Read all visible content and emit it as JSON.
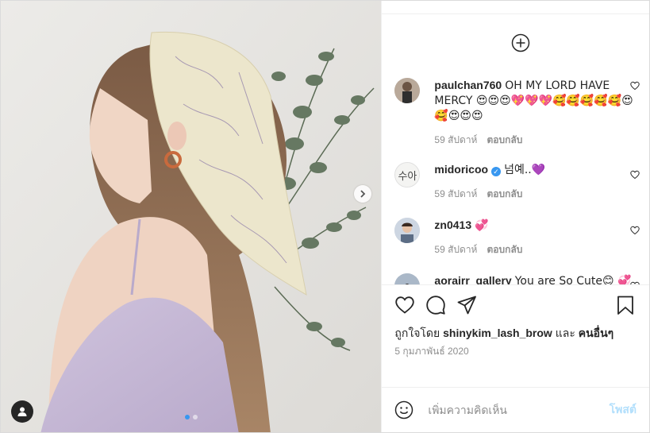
{
  "media": {
    "carousel_index": 0,
    "carousel_count": 2,
    "next_icon": "chevron-right-icon",
    "user_tag_icon": "person-icon"
  },
  "panel": {
    "load_more_icon": "plus-circle-icon",
    "comments": [
      {
        "username": "paulchan760",
        "text": "OH MY LORD HAVE MERCY 😍😍😍💖💖💖🥰🥰🥰🥰🥰😍🥰😍😍😍",
        "time": "59 สัปดาห์",
        "reply": "ตอบกลับ",
        "verified": false
      },
      {
        "username": "midoricoo",
        "text": "넘예..💜",
        "time": "59 สัปดาห์",
        "reply": "ตอบกลับ",
        "verified": true,
        "avatar_text": "수아"
      },
      {
        "username": "zn0413",
        "text": "💞",
        "time": "59 สัปดาห์",
        "reply": "ตอบกลับ",
        "verified": false
      },
      {
        "username": "aorairr_gallery",
        "text": "You are So Cute😊 💞",
        "verified": false
      }
    ]
  },
  "actions": {
    "like_icon": "heart-icon",
    "comment_icon": "comment-icon",
    "share_icon": "paper-plane-icon",
    "save_icon": "bookmark-icon",
    "likes_prefix": "ถูกใจโดย",
    "likes_user": "shinykim_lash_brow",
    "likes_and": "และ",
    "likes_others": "คนอื่นๆ",
    "date": "5 กุมภาพันธ์ 2020"
  },
  "add_comment": {
    "emoji_icon": "smiley-icon",
    "placeholder": "เพิ่มความคิดเห็น",
    "post_label": "โพสต์"
  },
  "colors": {
    "accent": "#3897f0",
    "post_disabled": "#b2dffc",
    "text": "#262626",
    "muted": "#8e8e8e",
    "border": "#efefef"
  }
}
